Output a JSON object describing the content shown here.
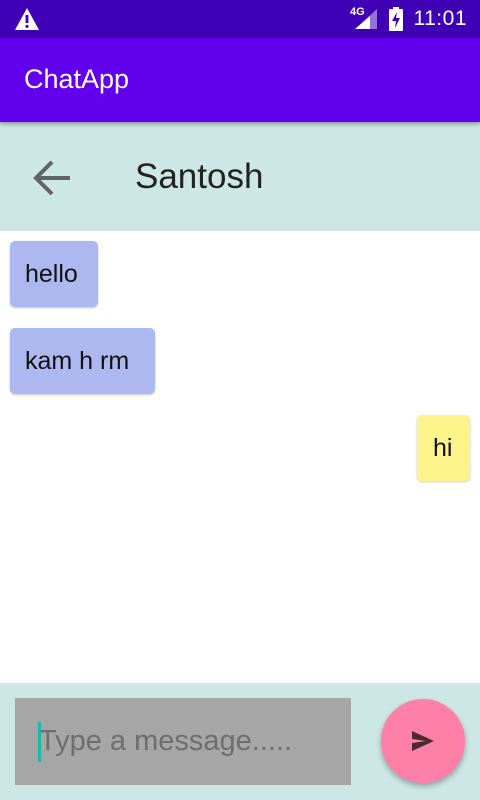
{
  "status_bar": {
    "network_label": "4G",
    "time": "11:01",
    "icons": [
      "warning-icon",
      "signal-icon",
      "battery-charging-icon"
    ]
  },
  "app_bar": {
    "title": "ChatApp"
  },
  "chat_header": {
    "back_icon": "arrow-back-icon",
    "contact_name": "Santosh"
  },
  "messages": [
    {
      "direction": "incoming",
      "text": "hello"
    },
    {
      "direction": "incoming",
      "text": "kam h rm"
    },
    {
      "direction": "outgoing",
      "text": "hi"
    }
  ],
  "composer": {
    "placeholder": "Type a message.....",
    "value": "",
    "send_icon": "send-icon"
  },
  "colors": {
    "status_bar": "#3f00b5",
    "app_bar": "#6200ee",
    "header_bg": "#cde7e4",
    "incoming_bubble": "#adb8f0",
    "outgoing_bubble": "#fff38c",
    "input_bg": "#a6a6a6",
    "send_button": "#fe80a8",
    "cursor": "#1db7a8"
  }
}
